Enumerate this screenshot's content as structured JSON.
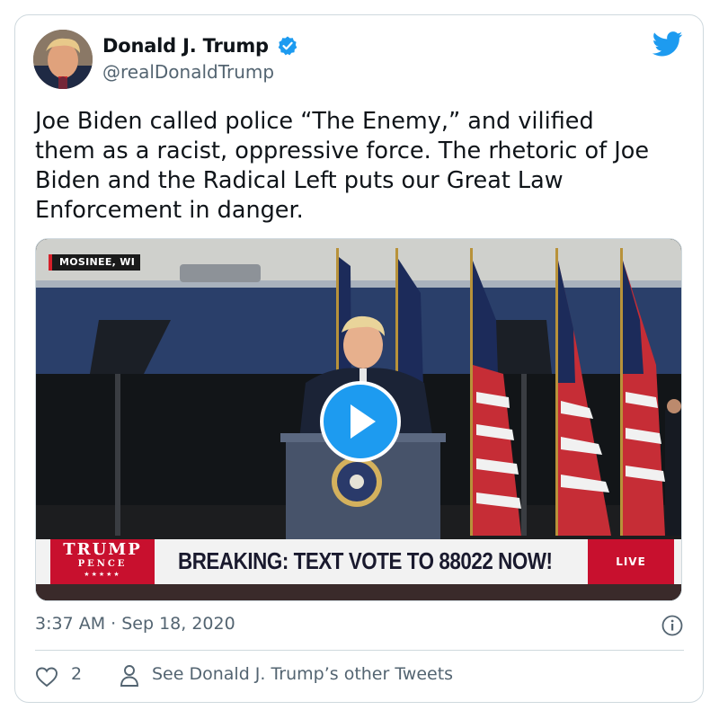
{
  "tweet": {
    "author_name": "Donald J. Trump",
    "author_handle": "@realDonaldTrump",
    "text": "Joe Biden called police “The Enemy,” and vilified\nthem as a racist, oppressive force. The rhetoric of Joe\nBiden and the Radical Left puts our Great Law\nEnforcement in danger.",
    "timestamp": "3:37 AM · Sep 18, 2020",
    "like_count": "2",
    "see_more_label": "See Donald J. Trump’s other Tweets"
  },
  "media": {
    "location_tag": "MOSINEE, WI",
    "logo_line1": "TRUMP",
    "logo_line2": "PENCE",
    "logo_stars": "★★★★★",
    "ticker_text": "BREAKING: TEXT VOTE TO 88022 NOW!",
    "live_label": "LIVE"
  },
  "icons": {
    "verified": "verified-badge-icon",
    "brand": "twitter-bird-icon",
    "play": "play-icon",
    "info": "info-icon",
    "like": "heart-icon",
    "profile": "person-icon"
  },
  "colors": {
    "accent": "#1d9bf0",
    "secondary_text": "#536471",
    "border": "#cfd9de",
    "ticker_red": "#c8102e"
  }
}
